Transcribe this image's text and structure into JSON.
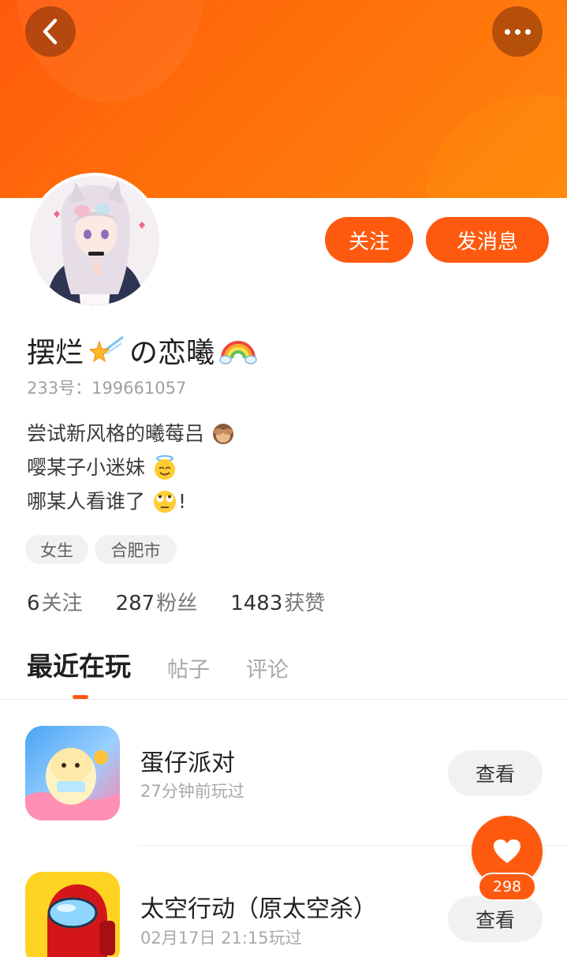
{
  "header": {
    "back_icon": "chevron-left-icon",
    "more_icon": "more-dots-icon",
    "accent": "#fe5a0f"
  },
  "profile": {
    "avatar": "anime-cat-girl-avatar",
    "nickname": "摆烂",
    "nickname_mid": "の恋曦",
    "uid": "233号：199661057",
    "bio": [
      "尝试新风格的曦莓吕",
      "嘤某子小迷妹",
      "哪某人看谁了"
    ],
    "bio_end": "!",
    "tags": {
      "gender": "女生",
      "city": "合肥市"
    }
  },
  "actions": {
    "follow": "关注",
    "message": "发消息"
  },
  "stats": [
    {
      "num": "6",
      "label": "关注"
    },
    {
      "num": "287",
      "label": "粉丝"
    },
    {
      "num": "1483",
      "label": "获赞"
    }
  ],
  "tabs": [
    "最近在玩",
    "帖子",
    "评论"
  ],
  "games": [
    {
      "title": "蛋仔派对",
      "time": "27分钟前玩过",
      "button": "查看",
      "icon": "eggy-party-icon"
    },
    {
      "title": "太空行动（原太空杀）",
      "time": "02月17日 21:15玩过",
      "button": "查看",
      "icon": "space-action-icon"
    }
  ],
  "like": {
    "icon": "heart-icon",
    "count": "298"
  }
}
